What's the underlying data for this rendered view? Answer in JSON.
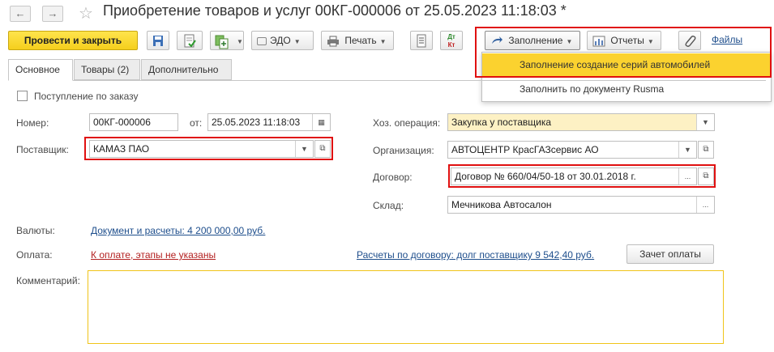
{
  "window": {
    "title": "Приобретение товаров и услуг 00КГ-000006 от 25.05.2023 11:18:03 *",
    "back_glyph": "←",
    "forward_glyph": "→",
    "star_glyph": "☆"
  },
  "toolbar": {
    "post_close_label": "Провести и закрыть",
    "edo_label": "ЭДО",
    "print_label": "Печать",
    "fill_label": "Заполнение",
    "reports_label": "Отчеты",
    "files_label": "Файлы",
    "dt_kt_top": "Дт",
    "dt_kt_bottom": "Кт"
  },
  "fill_menu": {
    "items": [
      {
        "label": "Заполнение создание серий автомобилей",
        "highlighted": true
      },
      {
        "label": "Заполнить по документу Rusma",
        "highlighted": false
      }
    ]
  },
  "tabs": [
    {
      "label": "Основное",
      "active": true
    },
    {
      "label": "Товары (2)",
      "active": false
    },
    {
      "label": "Дополнительно",
      "active": false
    }
  ],
  "form": {
    "by_order_label": "Поступление по заказу",
    "by_order_checked": false,
    "number_label": "Номер:",
    "number_value": "00КГ-000006",
    "date_label": "от:",
    "date_value": "25.05.2023 11:18:03",
    "supplier_label": "Поставщик:",
    "supplier_value": "КАМАЗ ПАО",
    "operation_label": "Хоз. операция:",
    "operation_value": "Закупка у поставщика",
    "organization_label": "Организация:",
    "organization_value": "АВТОЦЕНТР КрасГАЗсервис АО",
    "contract_label": "Договор:",
    "contract_value": "Договор № 660/04/50-18 от 30.01.2018 г.",
    "warehouse_label": "Склад:",
    "warehouse_value": "Мечникова Автосалон",
    "currency_label": "Валюты:",
    "currency_link": "Документ и расчеты: 4 200 000,00 руб.",
    "payment_label": "Оплата:",
    "payment_link": "К оплате, этапы не указаны",
    "settlements_link": "Расчеты по договору: долг поставщику 9 542,40 руб.",
    "offset_button": "Зачет оплаты",
    "comment_label": "Комментарий:",
    "comment_value": ""
  },
  "glyphs": {
    "dropdown": "▼",
    "ellipsis": "...",
    "open": "⧉"
  },
  "colors": {
    "primary_button": "#f5cf1d",
    "highlight": "#fbd22f",
    "annotation_red": "#e01010",
    "link_blue": "#1e4e8c",
    "link_red": "#b32020",
    "comment_border": "#f0c419"
  }
}
